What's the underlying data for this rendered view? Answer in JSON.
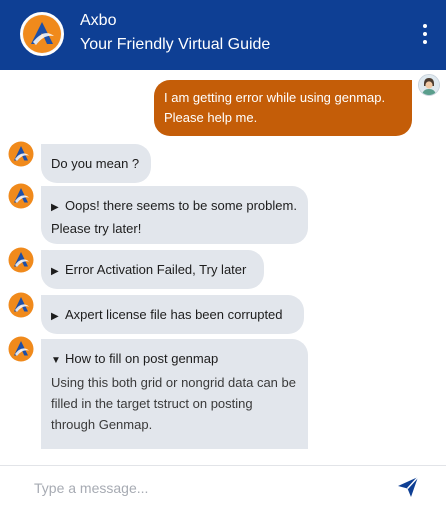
{
  "header": {
    "title": "Axbo",
    "subtitle": "Your Friendly Virtual Guide",
    "menu_icon": "kebab-menu-icon",
    "logo_icon": "axbo-logo-icon",
    "background": "#0e3f94"
  },
  "messages": {
    "user": {
      "text": "I am getting error while using genmap. Please help me.",
      "avatar_icon": "user-avatar-icon",
      "color": "#c45d08"
    },
    "bot": [
      {
        "title": "Do you mean ?"
      },
      {
        "caret": "▶",
        "title": "Oops! there seems to be some problem. Please try later!"
      },
      {
        "caret": "▶",
        "title": "Error Activation Failed, Try later"
      },
      {
        "caret": "▶",
        "title": "Axpert license file has been corrupted"
      },
      {
        "caret": "▼",
        "title": "How to fill on post genmap",
        "body": "Using this both grid or nongrid data can be filled in the target tstruct on posting through Genmap."
      }
    ]
  },
  "composer": {
    "placeholder": "Type a message...",
    "send_icon": "send-icon",
    "send_color": "#0e3f94"
  }
}
